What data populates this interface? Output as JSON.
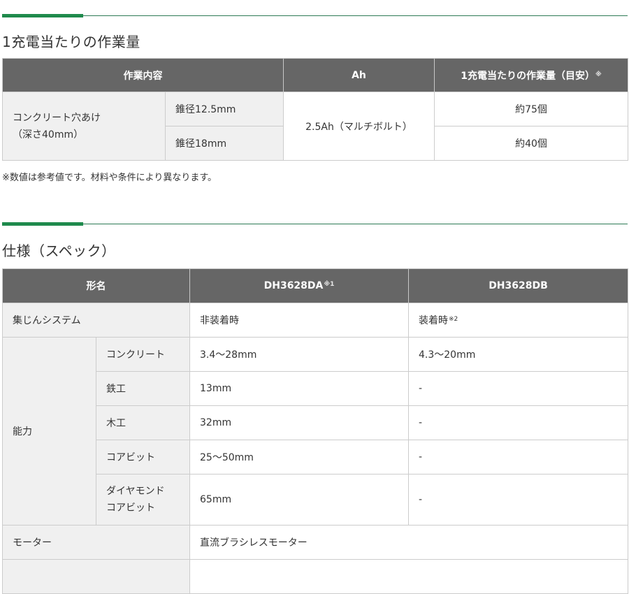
{
  "section1": {
    "title": "1充電当たりの作業量",
    "headers": {
      "work": "作業内容",
      "ah": "Ah",
      "amount": "1充電当たりの作業量（目安）",
      "amount_note": "※"
    },
    "task_line1": "コンクリート穴あけ",
    "task_line2": "（深さ40mm）",
    "rows": [
      {
        "diameter": "錐径12.5mm",
        "amount": "約75個"
      },
      {
        "diameter": "錐径18mm",
        "amount": "約40個"
      }
    ],
    "battery": "2.5Ah（マルチボルト）",
    "footnote": "※数値は参考値です。材料や条件により異なります。"
  },
  "section2": {
    "title": "仕様（スペック）",
    "headers": {
      "model": "形名",
      "col1": "DH3628DA",
      "col1_note": "※1",
      "col2": "DH3628DB"
    },
    "dust": {
      "label": "集じんシステム",
      "col1": "非装着時",
      "col2": "装着時",
      "col2_note": "※2"
    },
    "capacity_label": "能力",
    "capacity": [
      {
        "material": "コンクリート",
        "col1": "3.4〜28mm",
        "col2": "4.3〜20mm"
      },
      {
        "material": "鉄工",
        "col1": "13mm",
        "col2": "-"
      },
      {
        "material": "木工",
        "col1": "32mm",
        "col2": "-"
      },
      {
        "material": "コアビット",
        "col1": "25〜50mm",
        "col2": "-"
      }
    ],
    "diamond": {
      "line1": "ダイヤモンド",
      "line2": "コアビット",
      "col1": "65mm",
      "col2": "-"
    },
    "motor": {
      "label": "モーター",
      "value": "直流ブラシレスモーター"
    }
  }
}
